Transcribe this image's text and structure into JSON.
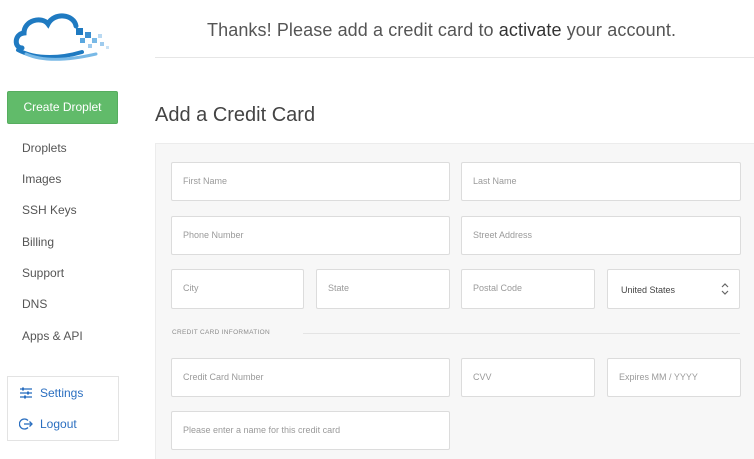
{
  "banner": {
    "text_before": "Thanks! Please add a credit card to ",
    "text_strong": "activate",
    "text_after": " your account."
  },
  "sidebar": {
    "create_label": "Create Droplet",
    "items": [
      {
        "label": "Droplets"
      },
      {
        "label": "Images"
      },
      {
        "label": "SSH Keys"
      },
      {
        "label": "Billing"
      },
      {
        "label": "Support"
      },
      {
        "label": "DNS"
      },
      {
        "label": "Apps & API"
      }
    ],
    "settings_label": "Settings",
    "logout_label": "Logout"
  },
  "form": {
    "title": "Add a Credit Card",
    "placeholders": {
      "first_name": "First Name",
      "last_name": "Last Name",
      "phone": "Phone Number",
      "street": "Street Address",
      "city": "City",
      "state": "State",
      "postal": "Postal Code",
      "card_number": "Credit Card Number",
      "cvv": "CVV",
      "expires": "Expires MM / YYYY",
      "card_name": "Please enter a name for this credit card"
    },
    "country": "United States",
    "section_label": "CREDIT CARD INFORMATION"
  },
  "colors": {
    "accent_green": "#61bb6a",
    "link_blue": "#2b6fc0",
    "logo_blue": "#1f7ac1"
  }
}
